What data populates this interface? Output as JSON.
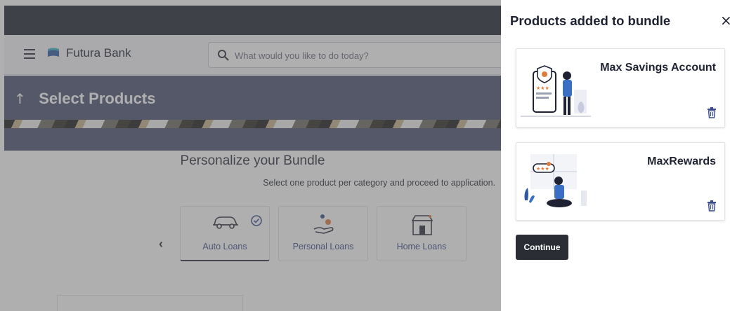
{
  "header": {
    "brand": "Futura Bank",
    "search_placeholder": "What would you like to do today?"
  },
  "banner": {
    "title": "Select Products"
  },
  "content": {
    "title": "Personalize your Bundle",
    "subtitle": "Select one product per category and proceed to application.",
    "categories": [
      {
        "label": "Auto Loans",
        "icon": "car-icon",
        "selected": true
      },
      {
        "label": "Personal Loans",
        "icon": "hand-coins-icon",
        "selected": false
      },
      {
        "label": "Home Loans",
        "icon": "store-icon",
        "selected": false
      }
    ]
  },
  "drawer": {
    "title": "Products added to bundle",
    "products": [
      {
        "name": "Max Savings Account"
      },
      {
        "name": "MaxRewards"
      }
    ],
    "continue_label": "Continue"
  },
  "colors": {
    "accent": "#3a4a8c",
    "banner": "#4a5170",
    "topbar": "#1f2233",
    "trash": "#3a4a8c",
    "button": "#2a2d33"
  }
}
